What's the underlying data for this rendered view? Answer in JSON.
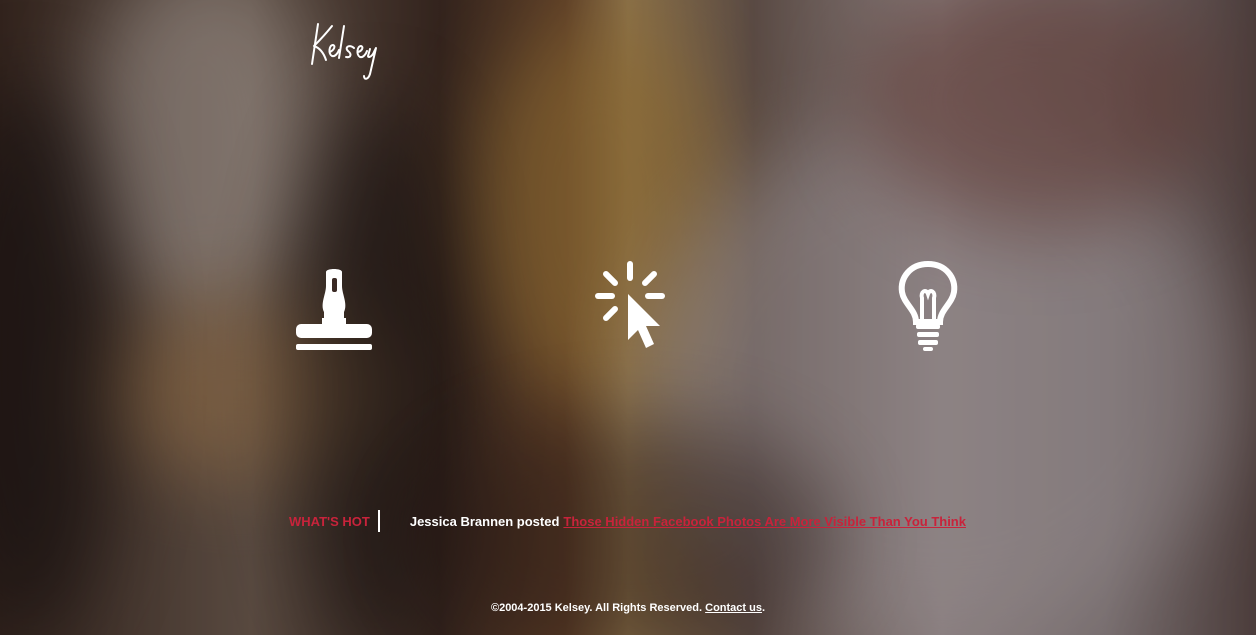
{
  "brand": {
    "logo_text": "Kelsey"
  },
  "icons": [
    {
      "name": "stamp-icon"
    },
    {
      "name": "cursor-click-icon"
    },
    {
      "name": "lightbulb-icon"
    }
  ],
  "whats_hot": {
    "label": "WHAT'S HOT",
    "author_text": "Jessica Brannen posted",
    "link_text": "Those Hidden Facebook Photos Are More Visible Than You Think"
  },
  "footer": {
    "copyright": "©2004-2015 Kelsey. All Rights Reserved.",
    "contact_label": "Contact us",
    "trailing": "."
  },
  "colors": {
    "accent_red": "#c8233b",
    "text_white": "#ffffff"
  }
}
